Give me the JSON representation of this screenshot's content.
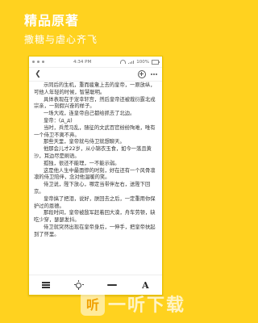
{
  "promo": {
    "headline": "精品原著",
    "subline": "撒糖与虐心齐飞"
  },
  "status_bar": {
    "time": "4:34 PM",
    "battery": "100%"
  },
  "reader": {
    "paragraphs": [
      "示同后的生机，重而疲惫上去的皇帝，一原放纵，可他人年轻的时候，智慧聪明。",
      "具体表现在于宠幸轩宫，然后皇帝还被裁衍霆北戎宗亲，一刻假兴奋的样子。",
      "一场大戏，连皇帝自己都给抓去了北边。",
      "皇帝：(д_д)",
      "当时，兵荒马乱，随征的文武百官纷纷殉难，唯有一个侍卫不离不弃。",
      "那些天里，皇帝就与侍卫就想聊天。",
      "他那会儿才22岁，从小锦衣玉食，如今一落且黄沙，耳边尽是刷语。",
      "孤独，很还不能理，一不能示弱。",
      "这是他人生中最面惨的时刻，好在还有一个风骨凛凛的侍卫陪伴，念对他温暖的笑。",
      "侍卫说，陛下放心，哪定当带伴左右，送陛下回京。",
      "皇帝搞了把泪，说好，朕回去之后，一定重用你保护过的恩德。",
      "那段时间，皇帝被敌军赶着回大漠，舟车劳顿，缺吃少穿，瑟瑟发抖。",
      "侍卫就突然出现在皇帝身后，一伸手，把皇帝扶起到了怀里。"
    ]
  },
  "watermark": {
    "text": "一听下载"
  }
}
